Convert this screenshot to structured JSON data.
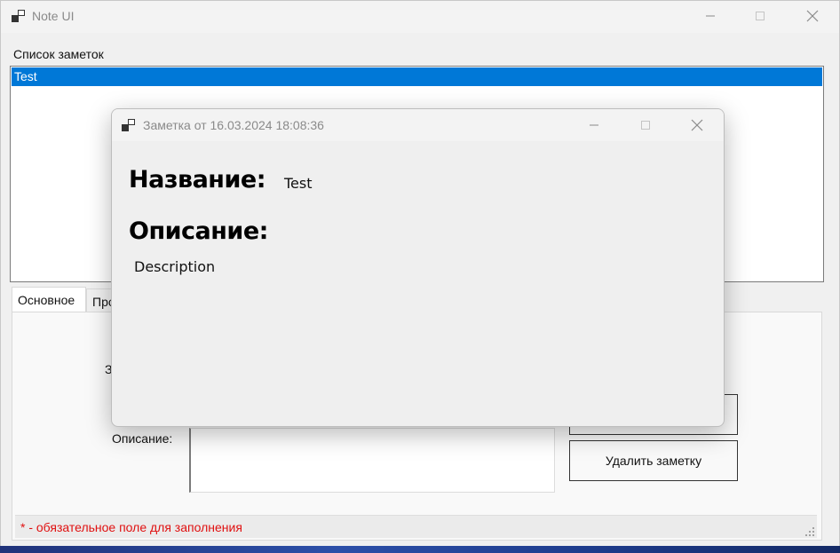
{
  "main_window": {
    "title": "Note UI",
    "notes_label": "Список заметок",
    "notes": [
      "Test"
    ],
    "tabs": [
      {
        "label": "Основное"
      },
      {
        "label": "Про"
      }
    ],
    "title_label_partial": "За",
    "description_label": "Описание:",
    "delete_button": "Удалить заметку",
    "status_text": "* - обязательное поле для заполнения"
  },
  "dialog": {
    "title": "Заметка от 16.03.2024 18:08:36",
    "name_heading": "Название:",
    "name_value": "Test",
    "description_heading": "Описание:",
    "description_value": "Description"
  },
  "icons": {
    "app": "app-window-icon",
    "minimize": "minimize-icon",
    "maximize": "maximize-icon",
    "close": "close-icon",
    "grip": "resize-grip-icon"
  },
  "colors": {
    "selection": "#0078d7",
    "status_text": "#e01010"
  }
}
